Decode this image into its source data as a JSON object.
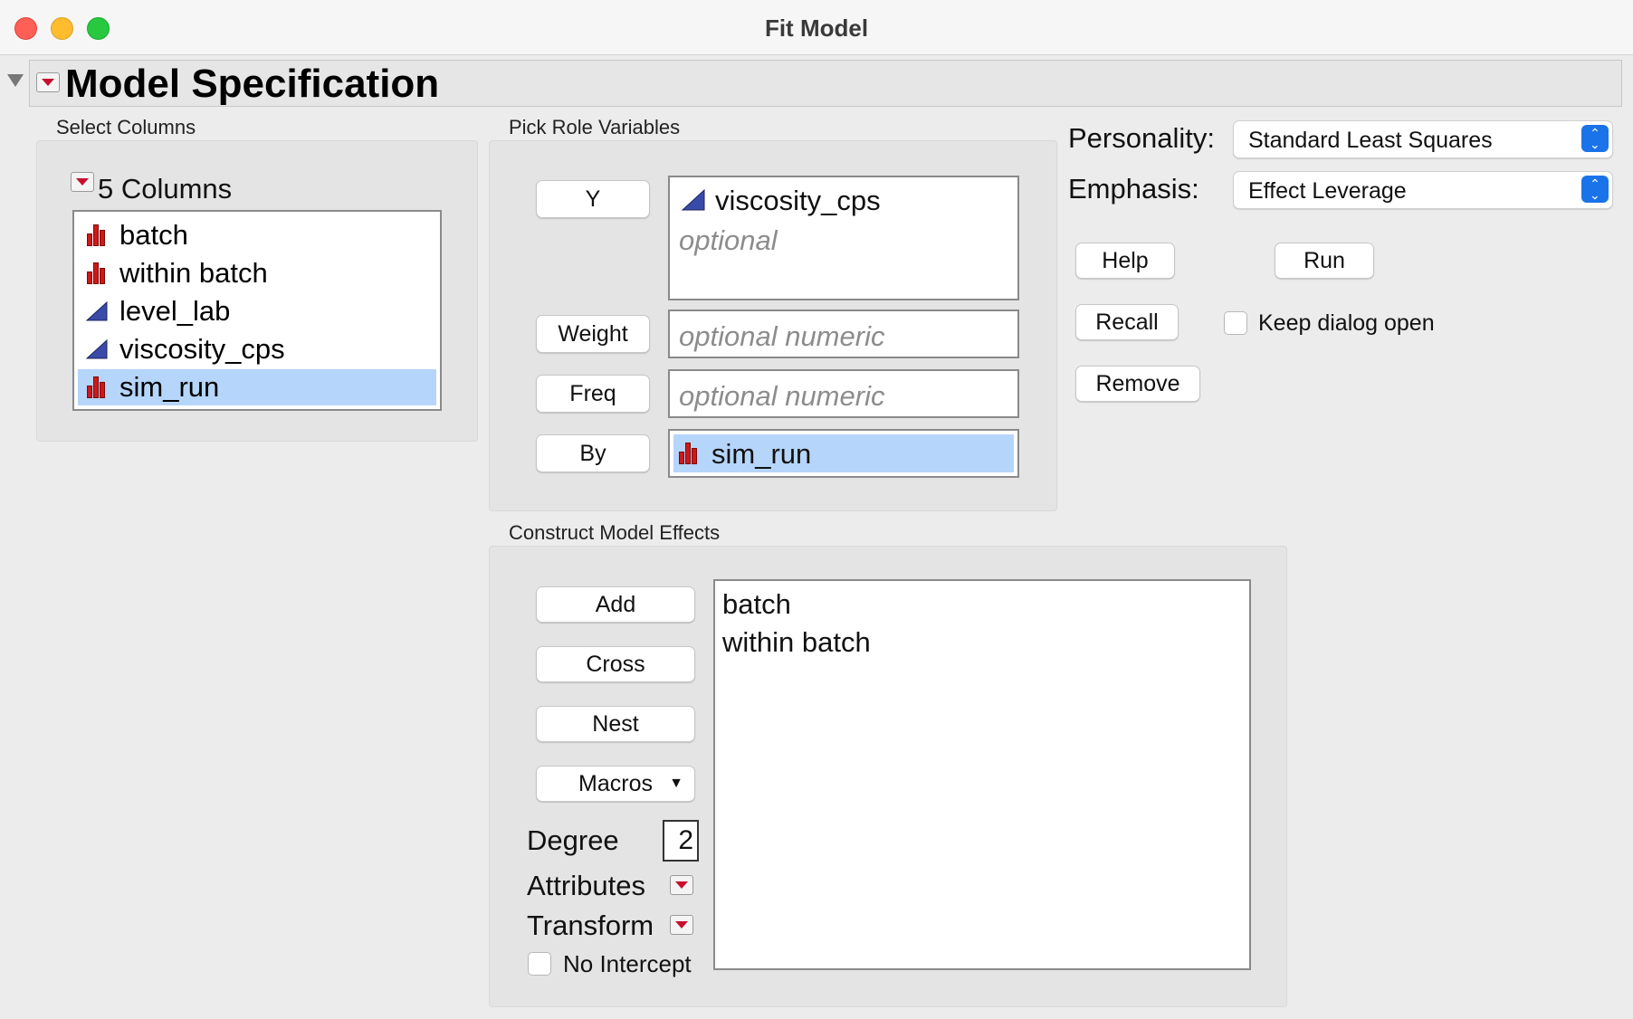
{
  "window": {
    "title": "Fit Model"
  },
  "outline": {
    "title": "Model Specification"
  },
  "select_columns": {
    "label": "Select Columns",
    "count_label": "5 Columns",
    "items": [
      {
        "label": "batch",
        "type": "nominal",
        "selected": false
      },
      {
        "label": "within batch",
        "type": "nominal",
        "selected": false
      },
      {
        "label": "level_lab",
        "type": "continuous",
        "selected": false
      },
      {
        "label": "viscosity_cps",
        "type": "continuous",
        "selected": false
      },
      {
        "label": "sim_run",
        "type": "nominal",
        "selected": true
      }
    ]
  },
  "roles": {
    "label": "Pick Role Variables",
    "y": {
      "button": "Y",
      "value": "viscosity_cps",
      "placeholder": "optional"
    },
    "weight": {
      "button": "Weight",
      "placeholder": "optional numeric"
    },
    "freq": {
      "button": "Freq",
      "placeholder": "optional numeric"
    },
    "by": {
      "button": "By",
      "value": "sim_run"
    }
  },
  "options": {
    "personality_label": "Personality:",
    "personality_value": "Standard Least Squares",
    "emphasis_label": "Emphasis:",
    "emphasis_value": "Effect Leverage",
    "help": "Help",
    "run": "Run",
    "recall": "Recall",
    "keep_open": "Keep dialog open",
    "keep_open_checked": false,
    "remove": "Remove"
  },
  "effects": {
    "label": "Construct Model Effects",
    "add": "Add",
    "cross": "Cross",
    "nest": "Nest",
    "macros": "Macros",
    "degree_label": "Degree",
    "degree_value": "2",
    "attributes": "Attributes",
    "transform": "Transform",
    "no_intercept": "No Intercept",
    "no_intercept_checked": false,
    "items": [
      "batch",
      "within batch"
    ]
  },
  "colors": {
    "selection": "#b5d5fb",
    "nominal_icon": "#d01818",
    "continuous_icon": "#3a4aa8",
    "accent": "#1a73e8"
  }
}
